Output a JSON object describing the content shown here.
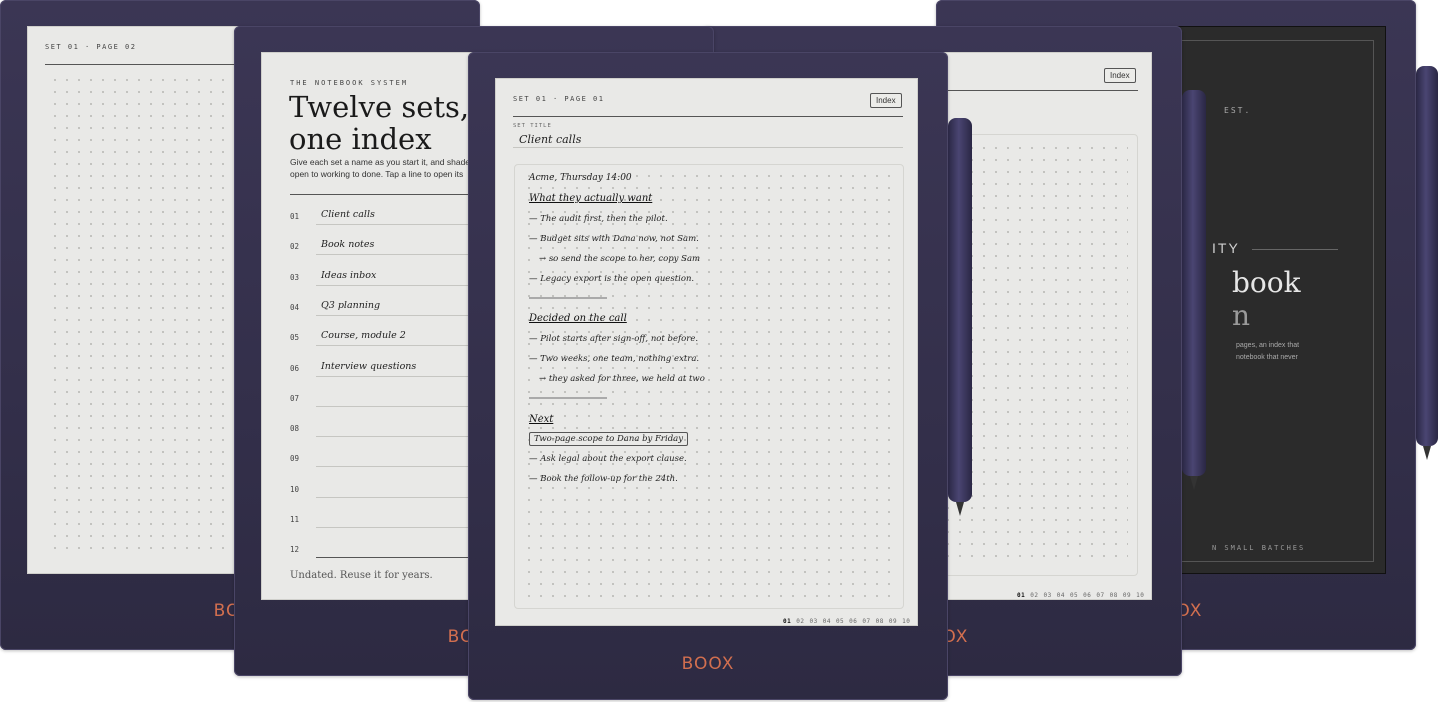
{
  "brand": "BOOX",
  "device_far_left": {
    "header": "SET 01 · PAGE 02"
  },
  "device_left": {
    "kicker": "THE NOTEBOOK SYSTEM",
    "title_line1": "Twelve sets,",
    "title_line2": "one index",
    "body": "Give each set a name as you start it, and shade open to working to done. Tap a line to open its",
    "index_rows": [
      {
        "num": "01",
        "title": "Client calls"
      },
      {
        "num": "02",
        "title": "Book notes"
      },
      {
        "num": "03",
        "title": "Ideas inbox"
      },
      {
        "num": "04",
        "title": "Q3 planning"
      },
      {
        "num": "05",
        "title": "Course, module 2"
      },
      {
        "num": "06",
        "title": "Interview questions"
      },
      {
        "num": "07",
        "title": ""
      },
      {
        "num": "08",
        "title": ""
      },
      {
        "num": "09",
        "title": ""
      },
      {
        "num": "10",
        "title": ""
      },
      {
        "num": "11",
        "title": ""
      },
      {
        "num": "12",
        "title": ""
      }
    ],
    "footer": "Undated. Reuse it for years."
  },
  "device_center": {
    "header": "SET 01 · PAGE 01",
    "index_button": "Index",
    "set_title_label": "SET TITLE",
    "set_title": "Client calls",
    "notes": {
      "meeting": "Acme, Thursday 14:00",
      "section1": "What they actually want",
      "s1_items": [
        "— The audit first, then the pilot.",
        "— Budget sits with Dana now, not Sam.",
        "→ so send the scope to her, copy Sam",
        "— Legacy export is the open question."
      ],
      "section2": "Decided on the call",
      "s2_items": [
        "— Pilot starts after sign-off, not before.",
        "— Two weeks, one team, nothing extra.",
        "→ they asked for three, we held at two"
      ],
      "section3": "Next",
      "s3_boxed": "Two-page scope to Dana by Friday",
      "s3_items": [
        "— Ask legal about the export clause.",
        "— Book the follow-up for the 24th."
      ]
    },
    "page_numbers": [
      "01",
      "02",
      "03",
      "04",
      "05",
      "06",
      "07",
      "08",
      "09",
      "10"
    ]
  },
  "device_right": {
    "index_button": "Index",
    "page_numbers": [
      "01",
      "02",
      "03",
      "04",
      "05",
      "06",
      "07",
      "08",
      "09",
      "10"
    ]
  },
  "device_far_right": {
    "est": "EST.",
    "kicker": "ITY",
    "title_line1": "book",
    "title_line2": "n",
    "body_line1": "pages, an index that",
    "body_line2": "notebook that never",
    "footer": "N SMALL BATCHES"
  }
}
